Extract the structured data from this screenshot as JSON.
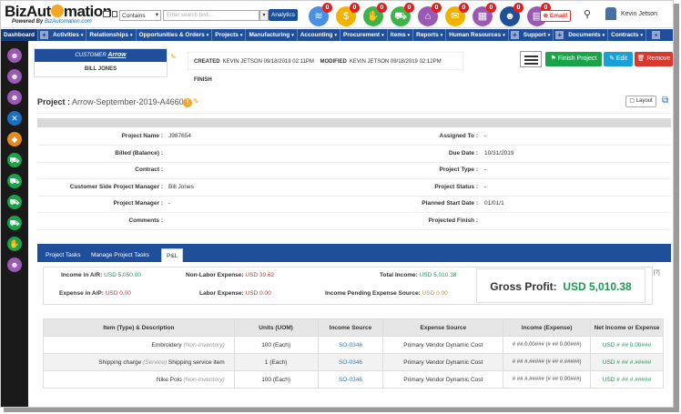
{
  "app": {
    "logo_text_left": "BizAut",
    "logo_text_right": "mation",
    "powered_by": "Powered By",
    "powered_by_link": "BizAutomation.com"
  },
  "search": {
    "scope": "Contains",
    "placeholder": "Enter search text...",
    "analytics_label": "Analytics"
  },
  "notifications": [
    {
      "name": "stack-icon",
      "glyph": "≋",
      "color": "#4a90e2",
      "count": "0"
    },
    {
      "name": "coins-icon",
      "glyph": "$",
      "color": "#f0b400",
      "count": "0"
    },
    {
      "name": "handshake-icon",
      "glyph": "✋",
      "color": "#3bb54a",
      "count": "0"
    },
    {
      "name": "cart-icon",
      "glyph": "⛟",
      "color": "#3bb54a",
      "count": "0"
    },
    {
      "name": "bag-icon",
      "glyph": "⌂",
      "color": "#9b59b6",
      "count": "0"
    },
    {
      "name": "mail-icon",
      "glyph": "✉",
      "color": "#f0b400",
      "count": "0"
    },
    {
      "name": "calendar-icon",
      "glyph": "▦",
      "color": "#9b59b6",
      "count": "0"
    },
    {
      "name": "team-icon",
      "glyph": "☻",
      "color": "#1f4e9a",
      "count": "0"
    },
    {
      "name": "doc-icon",
      "glyph": "▤",
      "color": "#9b59b6",
      "count": "0"
    }
  ],
  "email_label": "Email!",
  "user_name": "Kevin Jetson",
  "nav": {
    "items": [
      "Dashboard",
      "Activities",
      "Relationships",
      "Opportunities & Orders",
      "Projects",
      "Manufacturing",
      "Accounting",
      "Procurement",
      "Items",
      "Reports",
      "Human Resources",
      "Support",
      "Documents",
      "Contracts"
    ]
  },
  "sidebar": [
    {
      "name": "users-icon",
      "glyph": "☻",
      "color": "#9b59b6"
    },
    {
      "name": "contacts-icon",
      "glyph": "☻",
      "color": "#9b59b6"
    },
    {
      "name": "person-icon",
      "glyph": "☻",
      "color": "#9b59b6"
    },
    {
      "name": "tools-icon",
      "glyph": "✕",
      "color": "#1a6fc0"
    },
    {
      "name": "tag-icon",
      "glyph": "◆",
      "color": "#e58a20"
    },
    {
      "name": "cart-a-icon",
      "glyph": "⛟",
      "color": "#1aa34a"
    },
    {
      "name": "cart-b-icon",
      "glyph": "⛟",
      "color": "#1aa34a"
    },
    {
      "name": "cart-c-icon",
      "glyph": "⛟",
      "color": "#1aa34a"
    },
    {
      "name": "cart-d-icon",
      "glyph": "⛟",
      "color": "#1aa34a"
    },
    {
      "name": "handshake-side-icon",
      "glyph": "✋",
      "color": "#1aa34a"
    },
    {
      "name": "group-icon",
      "glyph": "☻",
      "color": "#9b59b6"
    }
  ],
  "record": {
    "customer_label": "CUSTOMER",
    "customer_name": "Arrow",
    "contact_name": "BILL JONES",
    "created_label": "CREATED",
    "created_value": "KEVIN JETSON 09/18/2019 02:11PM",
    "modified_label": "MODIFIED",
    "modified_value": "KEVIN JETSON 09/18/2019 02:12PM",
    "finish_label": "FINISH"
  },
  "actions": {
    "finish_project": "Finish Project",
    "edit": "Edit",
    "remove": "Remove"
  },
  "project": {
    "title_label": "Project :",
    "title_value": "Arrow-September-2019-A46600",
    "layout_label": "Layout"
  },
  "fields_left": [
    {
      "label": "Project Name :",
      "value": "J987654"
    },
    {
      "label": "Billed (Balance) :",
      "value": ""
    },
    {
      "label": "Contract :",
      "value": ""
    },
    {
      "label": "Customer Side Project Manager :",
      "value": "Bill Jones"
    },
    {
      "label": "Project Manager :",
      "value": "-"
    },
    {
      "label": "Comments :",
      "value": ""
    }
  ],
  "fields_right": [
    {
      "label": "Assigned To :",
      "value": "-"
    },
    {
      "label": "Due Date :",
      "value": "10/31/2019"
    },
    {
      "label": "Project Type :",
      "value": "-"
    },
    {
      "label": "Project Status :",
      "value": "-"
    },
    {
      "label": "Planned Start Date :",
      "value": "01/01/1"
    },
    {
      "label": "Projected Finish :",
      "value": ""
    }
  ],
  "tabs": [
    "Project Tasks",
    "Manage Project Tasks",
    "P&L"
  ],
  "summary": {
    "income_ar_label": "Income in A/R:",
    "income_ar_value": "USD 5,050.00",
    "expense_ap_label": "Expense in A/P:",
    "expense_ap_value": "USD 0.00",
    "non_labor_label": "Non-Labor Expense:",
    "non_labor_value": "USD 39.62",
    "labor_label": "Labor Expense:",
    "labor_value": "USD 0.00",
    "total_income_label": "Total Income:",
    "total_income_value": "USD 5,010.38",
    "pending_label": "Income Pending Expense Source:",
    "pending_value": "USD 0.00",
    "gross_profit_label": "Gross Profit:",
    "gross_profit_value": "USD 5,010.38",
    "note": "[?]"
  },
  "table": {
    "headers": [
      "Item (Type) & Description",
      "Units (UOM)",
      "Income Source",
      "Expense Source",
      "Income (Expense)",
      "Net Income or Expense"
    ],
    "rows": [
      {
        "item": "Embroidery",
        "type": "(Non-Inventory)",
        "desc": "",
        "units": "100 (Each)",
        "income_src": "SO-0346",
        "expense_src": "Primary Vendor Dynamic Cost",
        "income_exp": "# ##.0.00### (# ## 0.00###)",
        "net": "USD # ## 0.00###"
      },
      {
        "item": "Shipping charge",
        "type": "(Service)",
        "desc": "Shipping service item",
        "units": "1 (Each)",
        "income_src": "SO-0346",
        "expense_src": "Primary Vendor Dynamic Cost",
        "income_exp": "# ## #.##### (# ## #.#####)",
        "net": "USD # ## #.#####"
      },
      {
        "item": "Nike Polo",
        "type": "(Non-Inventory)",
        "desc": "",
        "units": "100 (Each)",
        "income_src": "SO-0346",
        "expense_src": "Primary Vendor Dynamic Cost",
        "income_exp": "# ## #.##### (# ## 0.00###)",
        "net": "USD # ## #.#####"
      }
    ]
  }
}
